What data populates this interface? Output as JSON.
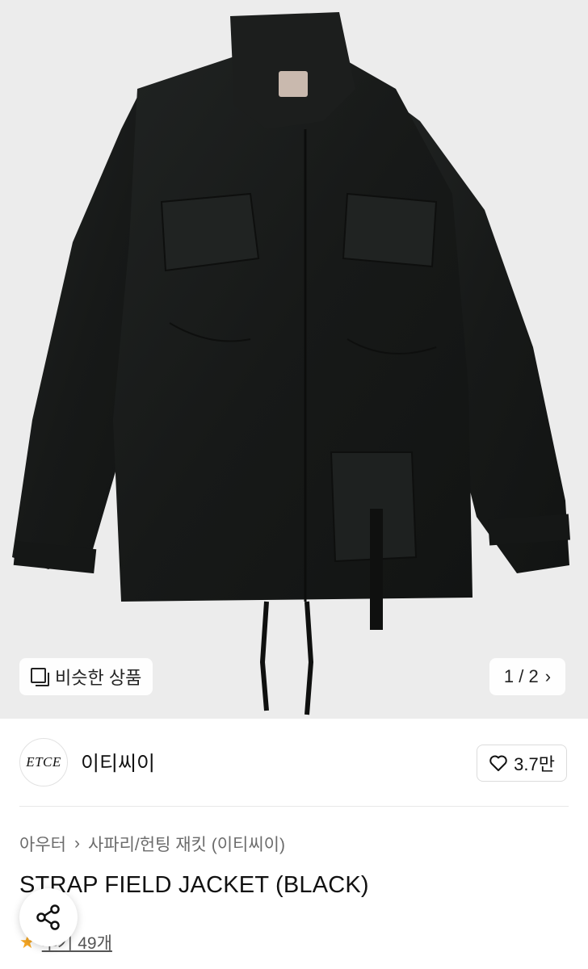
{
  "gallery": {
    "similar_label": "비슷한 상품",
    "pager_text": "1 / 2",
    "pager_chevron": "›",
    "logo_label_hint": "jacket neck label"
  },
  "brand": {
    "logo_text": "ETCE",
    "name": "이티씨이",
    "likes": "3.7만"
  },
  "breadcrumb": {
    "category": "아우터",
    "separator": "›",
    "subcategory": "사파리/헌팅 재킷 (이티씨이)"
  },
  "product": {
    "title": "STRAP FIELD JACKET (BLACK)"
  },
  "reviews": {
    "label": "후기 49개"
  },
  "colors": {
    "background": "#ececec",
    "jacket": "#1a1c1b",
    "star": "#f5a623"
  }
}
